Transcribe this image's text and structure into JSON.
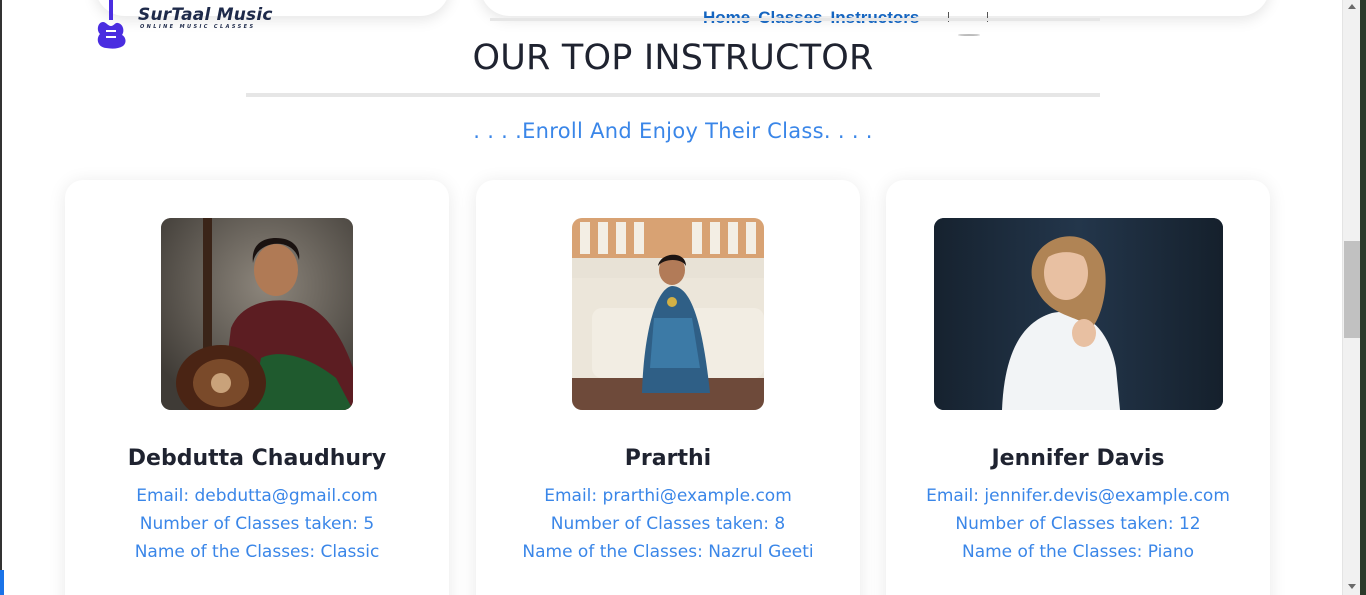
{
  "brand": {
    "title": "SurTaal Music",
    "subtitle": "ONLINE MUSIC CLASSES",
    "icon": "guitar-icon",
    "color": "#4a2de0"
  },
  "nav": {
    "links": [
      {
        "label": "Home"
      },
      {
        "label": "Classes"
      },
      {
        "label": "Instructors"
      }
    ],
    "link_color": "#1565c0"
  },
  "section": {
    "title": "OUR TOP INSTRUCTOR",
    "subtitle": ". . . .Enroll And Enjoy Their Class. . . .",
    "accent": "#3a86e8"
  },
  "instructors": [
    {
      "name": "Debdutta Chaudhury",
      "email": "Email: debdutta@gmail.com",
      "classes_taken": "Number of Classes taken: 5",
      "class_names": "Name of the Classes: Classic",
      "photo": "woman-with-tanpura-photo"
    },
    {
      "name": "Prarthi",
      "email": "Email: prarthi@example.com",
      "classes_taken": "Number of Classes taken: 8",
      "class_names": "Name of the Classes: Nazrul Geeti",
      "photo": "woman-on-sofa-photo"
    },
    {
      "name": "Jennifer Davis",
      "email": "Email: jennifer.devis@example.com",
      "classes_taken": "Number of Classes taken: 12",
      "class_names": "Name of the Classes: Piano",
      "photo": "woman-white-shirt-photo"
    }
  ]
}
